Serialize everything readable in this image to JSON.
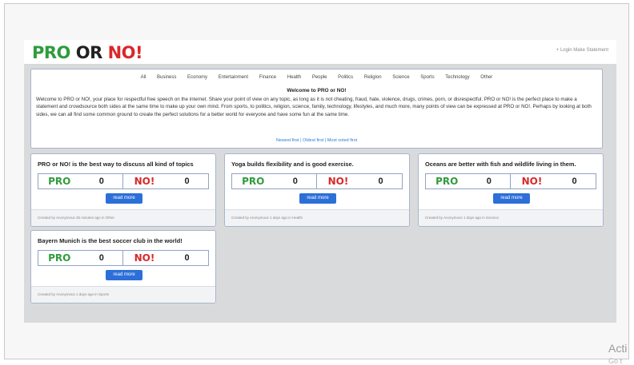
{
  "brand": {
    "pro": "PRO",
    "or": " OR ",
    "no": "NO!"
  },
  "top_links": "+ Login  Make Statement",
  "categories": [
    "All",
    "Business",
    "Economy",
    "Entertainment",
    "Finance",
    "Health",
    "People",
    "Politics",
    "Religion",
    "Science",
    "Sports",
    "Technology",
    "Other"
  ],
  "intro": {
    "title": "Welcome to PRO or NO!",
    "text": "Welcome to PRO or NO!, your place for respectful free speech on the internet. Share your point of view on any topic, as long as it is not cheating, fraud, hate, violence, drugs, crimes, porn, or disrespectful. PRO or NO! is the perfect place to make a statement and crowdsource both sides at the same time to make up your own mind. From sports, to politics, religion, science, family, technology, lifestyles, and much more, many points of view can be expressed at PRO or NO!. Perhaps by looking at both sides, we can all find some common ground to create the perfect solutions for a better world for everyone and have some fun at the same time.",
    "link": "Newest first | Oldest first | Most voted first"
  },
  "vote_labels": {
    "pro": "PRO",
    "no": "NO!"
  },
  "read_more_label": "read more",
  "cards": [
    {
      "title": "PRO or NO! is the best way to discuss all kind of topics",
      "pro": "0",
      "no": "0",
      "footer": "Created by Anonymous 35 minutes ago in Other"
    },
    {
      "title": "Yoga builds flexibility and is good exercise.",
      "pro": "0",
      "no": "0",
      "footer": "Created by Anonymous 1 days ago in Health"
    },
    {
      "title": "Oceans are better with fish and wildlife living in them.",
      "pro": "0",
      "no": "0",
      "footer": "Created by Anonymous 1 days ago in Science"
    },
    {
      "title": "Bayern Munich is the best soccer club in the world!",
      "pro": "0",
      "no": "0",
      "footer": "Created by Anonymous 1 days ago in Sports"
    }
  ],
  "overlay": {
    "activate": "Acti",
    "activate_sub": "Go t"
  },
  "colors": {
    "pro": "#2f9c3c",
    "no": "#d9282a",
    "button": "#2c6fd8",
    "border": "#a8b5cf"
  }
}
